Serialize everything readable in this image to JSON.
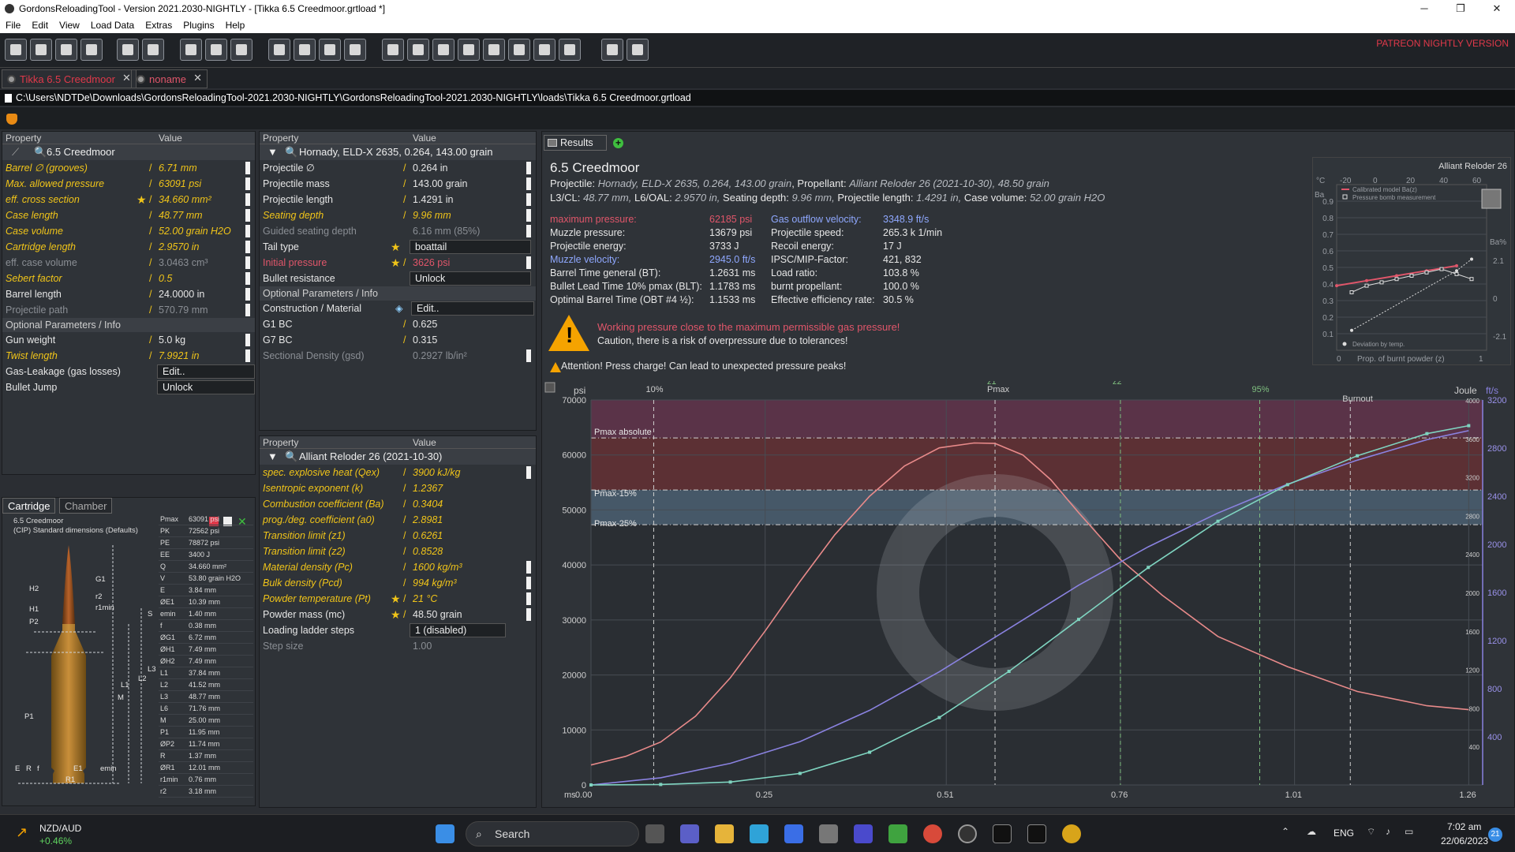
{
  "window": {
    "title": "GordonsReloadingTool - Version 2021.2030-NIGHTLY - [Tikka 6.5 Creedmoor.grtload *]"
  },
  "menu": [
    "File",
    "Edit",
    "View",
    "Load Data",
    "Extras",
    "Plugins",
    "Help"
  ],
  "patreon": "PATREON NIGHTLY VERSION",
  "tabs": [
    {
      "label": "Tikka 6.5 Creedmoor"
    },
    {
      "label": "noname"
    }
  ],
  "path": "C:\\Users\\NDTDe\\Downloads\\GordonsReloadingTool-2021.2030-NIGHTLY\\GordonsReloadingTool-2021.2030-NIGHTLY\\loads\\Tikka 6.5 Creedmoor.grtload",
  "headers": {
    "property": "Property",
    "value": "Value"
  },
  "cartridge_panel": {
    "selected": "6.5 Creedmoor",
    "rows": [
      {
        "k": "Barrel ∅ (grooves)",
        "v": "6.71 mm"
      },
      {
        "k": "Max. allowed pressure",
        "v": "63091 psi"
      },
      {
        "k": "eff. cross section",
        "v": "34.660 mm²"
      },
      {
        "k": "Case length",
        "v": "48.77 mm"
      },
      {
        "k": "Case volume",
        "v": "52.00 grain H2O"
      },
      {
        "k": "Cartridge length",
        "v": "2.9570 in"
      },
      {
        "k": "eff. case volume",
        "v": "3.0463 cm³"
      },
      {
        "k": "Sebert factor",
        "v": "0.5"
      },
      {
        "k": "Barrel length",
        "v": "24.0000 in"
      },
      {
        "k": "Projectile path",
        "v": "570.79 mm"
      }
    ],
    "optional_label": "Optional Parameters / Info",
    "optional": [
      {
        "k": "Gun weight",
        "v": "5.0 kg"
      },
      {
        "k": "Twist length",
        "v": "7.9921 in"
      },
      {
        "k": "Gas-Leakage (gas losses)",
        "v": "Edit.."
      },
      {
        "k": "Bullet Jump",
        "v": "Unlock"
      }
    ]
  },
  "projectile_panel": {
    "selected": "Hornady, ELD-X 2635, 0.264, 143.00 grain",
    "rows": [
      {
        "k": "Projectile ∅",
        "v": "0.264 in"
      },
      {
        "k": "Projectile mass",
        "v": "143.00 grain"
      },
      {
        "k": "Projectile length",
        "v": "1.4291 in"
      },
      {
        "k": "Seating depth",
        "v": "9.96 mm"
      },
      {
        "k": "Guided seating depth",
        "v": "6.16 mm (85%)"
      },
      {
        "k": "Tail type",
        "v": "boattail"
      },
      {
        "k": "Initial pressure",
        "v": "3626 psi"
      },
      {
        "k": "Bullet resistance",
        "v": "Unlock"
      }
    ],
    "optional_label": "Optional Parameters / Info",
    "optional": [
      {
        "k": "Construction / Material",
        "v": "Edit.."
      },
      {
        "k": "G1 BC",
        "v": "0.625"
      },
      {
        "k": "G7 BC",
        "v": "0.315"
      },
      {
        "k": "Sectional Density (gsd)",
        "v": "0.2927 lb/in²"
      }
    ]
  },
  "powder_panel": {
    "selected": "Alliant Reloder 26 (2021-10-30)",
    "rows": [
      {
        "k": "spec. explosive heat (Qex)",
        "v": "3900 kJ/kg"
      },
      {
        "k": "Isentropic exponent (k)",
        "v": "1.2367"
      },
      {
        "k": "Combustion coefficient (Ba)",
        "v": "0.3404"
      },
      {
        "k": "prog./deg. coefficient (a0)",
        "v": "2.8981"
      },
      {
        "k": "Transition limit (z1)",
        "v": "0.6261"
      },
      {
        "k": "Transition limit (z2)",
        "v": "0.8528"
      },
      {
        "k": "Material density (Pc)",
        "v": "1600 kg/m³"
      },
      {
        "k": "Bulk density (Pcd)",
        "v": "994 kg/m³"
      },
      {
        "k": "Powder temperature (Pt)",
        "v": "21 °C"
      },
      {
        "k": "Powder mass (mc)",
        "v": "48.50 grain"
      },
      {
        "k": "Loading ladder steps",
        "v": "1 (disabled)"
      },
      {
        "k": "Step size",
        "v": "1.00"
      }
    ]
  },
  "cartridge_view": {
    "tabs": [
      "Cartridge",
      "Chamber"
    ],
    "title": "6.5 Creedmoor",
    "subtitle": "(CIP) Standard dimensions (Defaults)",
    "dims": [
      [
        "Pmax",
        "63091 psi"
      ],
      [
        "PK",
        "72562 psi"
      ],
      [
        "PE",
        "78872 psi"
      ],
      [
        "EE",
        "3400 J"
      ],
      [
        "Q",
        "34.660 mm²"
      ],
      [
        "V",
        "53.80 grain H2O"
      ],
      [
        "E",
        "3.84 mm"
      ],
      [
        "ØE1",
        "10.39 mm"
      ],
      [
        "emin",
        "1.40 mm"
      ],
      [
        "f",
        "0.38 mm"
      ],
      [
        "ØG1",
        "6.72 mm"
      ],
      [
        "ØH1",
        "7.49 mm"
      ],
      [
        "ØH2",
        "7.49 mm"
      ],
      [
        "L1",
        "37.84 mm"
      ],
      [
        "L2",
        "41.52 mm"
      ],
      [
        "L3",
        "48.77 mm"
      ],
      [
        "L6",
        "71.76 mm"
      ],
      [
        "M",
        "25.00 mm"
      ],
      [
        "P1",
        "11.95 mm"
      ],
      [
        "ØP2",
        "11.74 mm"
      ],
      [
        "R",
        "1.37 mm"
      ],
      [
        "ØR1",
        "12.01 mm"
      ],
      [
        "r1min",
        "0.76 mm"
      ],
      [
        "r2",
        "3.18 mm"
      ]
    ],
    "labels": [
      "G1",
      "H2",
      "r2",
      "r1min",
      "H1",
      "P2",
      "L1",
      "L2",
      "L3",
      "M",
      "P1",
      "E",
      "R",
      "f",
      "E1",
      "R1",
      "emin",
      "S"
    ]
  },
  "results": {
    "tab": "Results",
    "title": "6.5 Creedmoor",
    "projectile_label": "Projectile:",
    "projectile": "Hornady, ELD-X 2635, 0.264, 143.00 grain",
    "propellant_label": "Propellant:",
    "propellant": "Alliant Reloder 26 (2021-10-30), 48.50 grain",
    "geom_l3_label": "L3/CL:",
    "geom_l3": "48.77 mm,",
    "geom_l6_label": "L6/OAL:",
    "geom_l6": "2.9570 in,",
    "geom_seat_label": "Seating depth:",
    "geom_seat": "9.96 mm,",
    "geom_plen_label": "Projectile length:",
    "geom_plen": "1.4291 in,",
    "geom_cv_label": "Case volume:",
    "geom_cv": "52.00 grain H2O",
    "stats_left": [
      {
        "k": "maximum pressure:",
        "v": "62185 psi",
        "c": "#e0566a"
      },
      {
        "k": "Muzzle pressure:",
        "v": "13679 psi",
        "c": "#e6e6e6"
      },
      {
        "k": "Projectile energy:",
        "v": "3733 J",
        "c": "#e6e6e6"
      },
      {
        "k": "Muzzle velocity:",
        "v": "2945.0 ft/s",
        "c": "#8fa8ff"
      },
      {
        "k": "Barrel Time general (BT):",
        "v": "1.2631 ms",
        "c": "#e6e6e6"
      },
      {
        "k": "Bullet Lead Time 10% pmax (BLT):",
        "v": "1.1783 ms",
        "c": "#e6e6e6"
      },
      {
        "k": "Optimal Barrel Time (OBT #4 ½):",
        "v": "1.1533 ms",
        "c": "#e6e6e6"
      }
    ],
    "stats_right": [
      {
        "k": "Gas outflow velocity:",
        "v": "3348.9 ft/s",
        "c": "#8fa8ff"
      },
      {
        "k": "Projectile speed:",
        "v": "265.3 k 1/min",
        "c": "#e6e6e6"
      },
      {
        "k": "Recoil energy:",
        "v": "17 J",
        "c": "#e6e6e6"
      },
      {
        "k": "IPSC/MIP-Factor:",
        "v": "421, 832",
        "c": "#e6e6e6"
      },
      {
        "k": "Load ratio:",
        "v": "103.8 %",
        "c": "#e6e6e6"
      },
      {
        "k": "burnt propellant:",
        "v": "100.0 %",
        "c": "#e6e6e6"
      },
      {
        "k": "Effective efficiency rate:",
        "v": "30.5 %",
        "c": "#e6e6e6"
      }
    ],
    "warning_title": "Working pressure close to the maximum permissible gas pressure!",
    "warning_text": "Caution, there is a risk of overpressure due to tolerances!",
    "attention": "Attention! Press charge! Can lead to unexpected pressure peaks!",
    "mini_chart_title": "Alliant Reloder 26"
  },
  "chart_data": [
    {
      "type": "line",
      "x_unit": "ms",
      "x_ticks": [
        0.0,
        0.25,
        0.51,
        0.76,
        1.01,
        1.26
      ],
      "x_tick_labels": [
        "0.00",
        "0.25",
        "0.51",
        "0.76",
        "1.01",
        "1.26"
      ],
      "xlim": [
        0,
        1.28
      ],
      "ylabel_left": "psi",
      "ylim_left": [
        0,
        70000
      ],
      "y_ticks_left": [
        0,
        10000,
        20000,
        30000,
        40000,
        50000,
        60000,
        70000
      ],
      "ylabel_right_1": "Joule",
      "ylabel_right_2": "ft/s",
      "y_ticks_right_joule": [
        400,
        800,
        1200,
        1600,
        2000,
        2400,
        2800,
        3200,
        3600,
        4000
      ],
      "y_ticks_right_fts": [
        400,
        800,
        1200,
        1600,
        2000,
        2400,
        2800,
        3200
      ],
      "ylim_right_joule": [
        0,
        4000
      ],
      "ylim_right_fts": [
        0,
        3200
      ],
      "bands": [
        {
          "label": "Pmax absolute",
          "y": 63091
        },
        {
          "label": "Pmax-15%",
          "y": 53627
        },
        {
          "label": "Pmax-25%",
          "y": 47318
        }
      ],
      "vlines": [
        {
          "label": "10%",
          "x": 0.09
        },
        {
          "label": "Pmax",
          "x": 0.58
        },
        {
          "label": "z1",
          "x": 0.58
        },
        {
          "label": "z2",
          "x": 0.76
        },
        {
          "label": "95%",
          "x": 0.96
        },
        {
          "label": "Burnout",
          "x": 1.09
        }
      ],
      "series": [
        {
          "name": "pressure",
          "axis": "psi",
          "color": "#e88a8a",
          "x": [
            0.0,
            0.05,
            0.1,
            0.15,
            0.2,
            0.25,
            0.3,
            0.35,
            0.4,
            0.45,
            0.5,
            0.55,
            0.58,
            0.62,
            0.66,
            0.7,
            0.76,
            0.82,
            0.9,
            1.0,
            1.1,
            1.2,
            1.26
          ],
          "y": [
            3626,
            5200,
            7800,
            12500,
            19500,
            28000,
            37000,
            45500,
            52500,
            58000,
            61300,
            62185,
            62100,
            60000,
            55500,
            49500,
            41000,
            34500,
            27000,
            21500,
            17000,
            14400,
            13679
          ]
        },
        {
          "name": "velocity",
          "axis": "ft/s",
          "color": "#8a82e0",
          "x": [
            0.0,
            0.1,
            0.2,
            0.3,
            0.4,
            0.5,
            0.6,
            0.7,
            0.8,
            0.9,
            1.0,
            1.1,
            1.2,
            1.26
          ],
          "y": [
            0,
            60,
            180,
            360,
            620,
            940,
            1300,
            1660,
            1980,
            2260,
            2500,
            2700,
            2870,
            2945
          ]
        },
        {
          "name": "energy",
          "axis": "Joule",
          "color": "#7fd4c0",
          "x": [
            0.0,
            0.1,
            0.2,
            0.3,
            0.4,
            0.5,
            0.6,
            0.7,
            0.8,
            0.9,
            1.0,
            1.1,
            1.2,
            1.26
          ],
          "y": [
            0,
            5,
            30,
            120,
            340,
            700,
            1180,
            1720,
            2260,
            2740,
            3120,
            3420,
            3650,
            3733
          ]
        }
      ]
    },
    {
      "type": "line",
      "title": "Alliant Reloder 26",
      "xlabel": "Prop. of burnt powder (z)",
      "x_ticks": [
        0,
        1
      ],
      "top_axis_label": "°C",
      "top_ticks": [
        -20,
        0,
        20,
        40,
        60
      ],
      "ylabel_left": "Ba",
      "y_ticks": [
        0.1,
        0.2,
        0.3,
        0.4,
        0.5,
        0.6,
        0.7,
        0.8,
        0.9
      ],
      "ylim": [
        0,
        1.0
      ],
      "ylabel_right": "Ba%",
      "y_ticks_right": [
        2.1,
        0.0,
        -2.1
      ],
      "legend": [
        "Calibrated model Ba(z)",
        "Pressure bomb measurement",
        "Deviation by temp."
      ],
      "series": [
        {
          "name": "Calibrated model Ba(z)",
          "color": "#e0566a",
          "x": [
            0,
            0.2,
            0.4,
            0.6,
            0.8
          ],
          "y": [
            0.39,
            0.42,
            0.45,
            0.48,
            0.51
          ]
        },
        {
          "name": "Pressure bomb measurement",
          "color": "#dddddd",
          "x": [
            0.1,
            0.2,
            0.3,
            0.4,
            0.5,
            0.6,
            0.7,
            0.8,
            0.9
          ],
          "y": [
            0.35,
            0.39,
            0.41,
            0.43,
            0.45,
            0.47,
            0.49,
            0.46,
            0.43
          ]
        },
        {
          "name": "Deviation by temp.",
          "color": "#dddddd",
          "x": [
            0.1,
            0.8,
            0.9
          ],
          "y": [
            0.12,
            0.48,
            0.55
          ]
        }
      ]
    }
  ],
  "taskbar": {
    "ticker": "NZD/AUD",
    "ticker_change": "+0.46%",
    "search": "Search",
    "lang": "ENG",
    "time": "7:02 am",
    "date": "22/06/2023",
    "badge": "21"
  }
}
